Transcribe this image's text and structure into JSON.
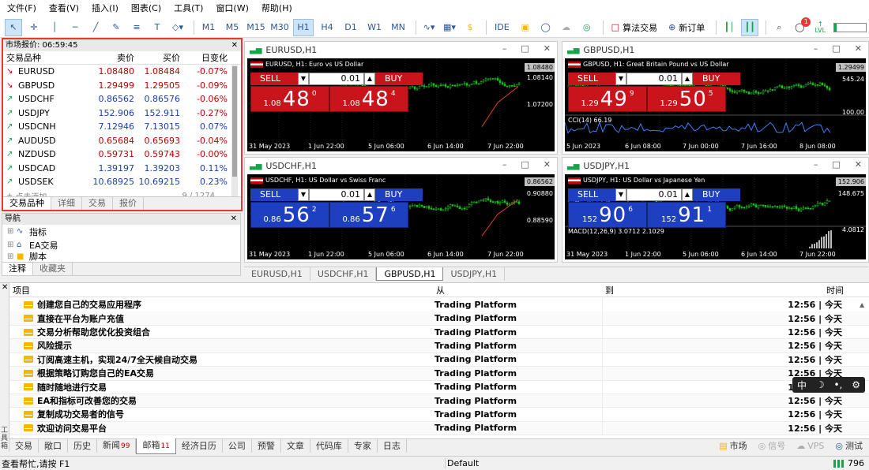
{
  "menubar": {
    "items": [
      "文件(F)",
      "查看(V)",
      "插入(I)",
      "图表(C)",
      "工具(T)",
      "窗口(W)",
      "帮助(H)"
    ]
  },
  "toolbar": {
    "timeframes": [
      "M1",
      "M5",
      "M15",
      "M30",
      "H1",
      "H4",
      "D1",
      "W1",
      "MN"
    ],
    "active_timeframe": "H1",
    "ide_label": "IDE",
    "algo_label": "算法交易",
    "new_order_label": "新订单",
    "notification_count": "1",
    "lvl_label": "LVL"
  },
  "market_watch": {
    "title": "市场报价: 06:59:45",
    "columns": [
      "交易品种",
      "卖价",
      "买价",
      "日变化"
    ],
    "rows": [
      {
        "symbol": "EURUSD",
        "bid": "1.08480",
        "ask": "1.08484",
        "change": "-0.07%",
        "trend": "down",
        "price_color": "red"
      },
      {
        "symbol": "GBPUSD",
        "bid": "1.29499",
        "ask": "1.29505",
        "change": "-0.09%",
        "trend": "down",
        "price_color": "red"
      },
      {
        "symbol": "USDCHF",
        "bid": "0.86562",
        "ask": "0.86576",
        "change": "-0.06%",
        "trend": "up",
        "price_color": "blue"
      },
      {
        "symbol": "USDJPY",
        "bid": "152.906",
        "ask": "152.911",
        "change": "-0.27%",
        "trend": "up",
        "price_color": "blue"
      },
      {
        "symbol": "USDCNH",
        "bid": "7.12946",
        "ask": "7.13015",
        "change": "0.07%",
        "trend": "up",
        "price_color": "blue"
      },
      {
        "symbol": "AUDUSD",
        "bid": "0.65684",
        "ask": "0.65693",
        "change": "-0.04%",
        "trend": "up",
        "price_color": "red"
      },
      {
        "symbol": "NZDUSD",
        "bid": "0.59731",
        "ask": "0.59743",
        "change": "-0.00%",
        "trend": "up",
        "price_color": "red"
      },
      {
        "symbol": "USDCAD",
        "bid": "1.39197",
        "ask": "1.39203",
        "change": "0.11%",
        "trend": "up",
        "price_color": "blue"
      },
      {
        "symbol": "USDSEK",
        "bid": "10.68925",
        "ask": "10.69215",
        "change": "0.23%",
        "trend": "up",
        "price_color": "blue"
      }
    ],
    "footer_text": "点击添加",
    "footer_count": "9 / 1274",
    "tabs": [
      "交易品种",
      "详细",
      "交易",
      "报价"
    ],
    "active_tab": "交易品种"
  },
  "navigator": {
    "title": "导航",
    "items": [
      "指标",
      "EA交易",
      "脚本"
    ],
    "tabs": [
      "注释",
      "收藏夹"
    ]
  },
  "charts": [
    {
      "title": "EURUSD,H1",
      "desc": "EURUSD, H1:  Euro vs US Dollar",
      "lot": "0.01",
      "sell": {
        "small": "1.08",
        "big": "48",
        "sup": "0"
      },
      "buy": {
        "small": "1.08",
        "big": "48",
        "sup": "4"
      },
      "price_tag": "1.08480",
      "price_labels": [
        "1.08140",
        "1.07200"
      ],
      "times": [
        "31 May 2023",
        "1 Jun 22:00",
        "5 Jun 06:00",
        "6 Jun 14:00",
        "7 Jun 22:00"
      ],
      "theme": "red"
    },
    {
      "title": "GBPUSD,H1",
      "desc": "GBPUSD, H1:  Great Britain Pound vs US Dollar",
      "lot": "0.01",
      "sell": {
        "small": "1.29",
        "big": "49",
        "sup": "9"
      },
      "buy": {
        "small": "1.29",
        "big": "50",
        "sup": "5"
      },
      "price_tag": "1.29499",
      "price_labels": [
        "545.24",
        "100.00"
      ],
      "indicator": "CCI(14) 66.19",
      "times": [
        "5 Jun 2023",
        "6 Jun 08:00",
        "7 Jun 00:00",
        "7 Jun 16:00",
        "8 Jun 08:00"
      ],
      "theme": "red"
    },
    {
      "title": "USDCHF,H1",
      "desc": "USDCHF, H1:  US Dollar vs Swiss Franc",
      "lot": "0.01",
      "sell": {
        "small": "0.86",
        "big": "56",
        "sup": "2"
      },
      "buy": {
        "small": "0.86",
        "big": "57",
        "sup": "6"
      },
      "price_tag": "0.86562",
      "price_labels": [
        "0.90880",
        "0.88590"
      ],
      "times": [
        "31 May 2023",
        "1 Jun 22:00",
        "5 Jun 06:00",
        "6 Jun 14:00",
        "7 Jun 22:00"
      ],
      "theme": "blue"
    },
    {
      "title": "USDJPY,H1",
      "desc": "USDJPY, H1:  US Dollar vs Japanese Yen",
      "lot": "0.01",
      "sell": {
        "small": "152",
        "big": "90",
        "sup": "6"
      },
      "buy": {
        "small": "152",
        "big": "91",
        "sup": "1"
      },
      "price_tag": "152.906",
      "price_labels": [
        "148.675",
        "4.0812"
      ],
      "indicator": "MACD(12,26,9) 3.0712 2.1029",
      "times": [
        "31 May 2023",
        "1 Jun 22:00",
        "5 Jun 06:00",
        "6 Jun 14:00",
        "7 Jun 22:00"
      ],
      "theme": "blue"
    }
  ],
  "chart_tabs": [
    "EURUSD,H1",
    "USDCHF,H1",
    "GBPUSD,H1",
    "USDJPY,H1"
  ],
  "active_chart_tab": "GBPUSD,H1",
  "toolbox": {
    "side_label": "工具箱",
    "columns": [
      "项目",
      "从",
      "到",
      "时间"
    ],
    "rows": [
      {
        "item": "创建您自己的交易应用程序",
        "from": "Trading Platform",
        "time": "12:56 | 今天"
      },
      {
        "item": "直接在平台为账户充值",
        "from": "Trading Platform",
        "time": "12:56 | 今天"
      },
      {
        "item": "交易分析帮助您优化投资组合",
        "from": "Trading Platform",
        "time": "12:56 | 今天"
      },
      {
        "item": "风险提示",
        "from": "Trading Platform",
        "time": "12:56 | 今天"
      },
      {
        "item": "订阅高速主机，实现24/7全天候自动交易",
        "from": "Trading Platform",
        "time": "12:56 | 今天"
      },
      {
        "item": "根据策略订购您自己的EA交易",
        "from": "Trading Platform",
        "time": "12:56 | 今天"
      },
      {
        "item": "随时随地进行交易",
        "from": "Trading Platform",
        "time": "12:56 | 今天"
      },
      {
        "item": "EA和指标可改善您的交易",
        "from": "Trading Platform",
        "time": "12:56 | 今天"
      },
      {
        "item": "复制成功交易者的信号",
        "from": "Trading Platform",
        "time": "12:56 | 今天"
      },
      {
        "item": "欢迎访问交易平台",
        "from": "Trading Platform",
        "time": "12:56 | 今天"
      }
    ]
  },
  "lang_pill": {
    "lang": "中"
  },
  "bottom_tabs": [
    {
      "label": "交易"
    },
    {
      "label": "敞口"
    },
    {
      "label": "历史"
    },
    {
      "label": "新闻",
      "badge": "99"
    },
    {
      "label": "邮箱",
      "badge": "11",
      "active": true
    },
    {
      "label": "经济日历"
    },
    {
      "label": "公司"
    },
    {
      "label": "预警"
    },
    {
      "label": "文章"
    },
    {
      "label": "代码库"
    },
    {
      "label": "专家"
    },
    {
      "label": "日志"
    }
  ],
  "bottom_right": {
    "market": "市场",
    "signals": "信号",
    "vps": "VPS",
    "tester": "测试"
  },
  "statusbar": {
    "help": "查看帮忙,请按 F1",
    "profile": "Default",
    "rate": "796"
  }
}
